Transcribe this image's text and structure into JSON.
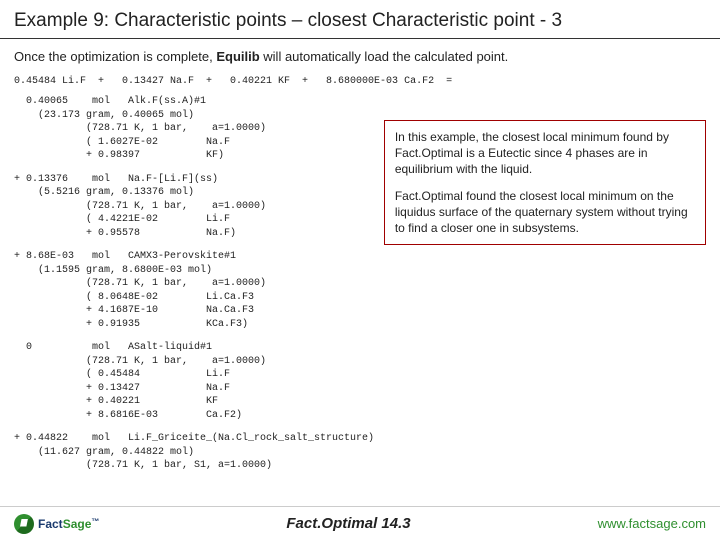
{
  "title": "Example 9: Characteristic points – closest Characteristic point - 3",
  "intro_before": "Once the optimization is complete, ",
  "intro_bold": "Equilib",
  "intro_after": " will automatically load the calculated point.",
  "equation": "0.45484 Li.F  +   0.13427 Na.F  +   0.40221 KF  +   8.680000E-03 Ca.F2  =",
  "blocks": [
    "  0.40065    mol   Alk.F(ss.A)#1\n    (23.173 gram, 0.40065 mol)\n            (728.71 K, 1 bar,    a=1.0000)\n            ( 1.6027E-02        Na.F\n            + 0.98397           KF)",
    "+ 0.13376    mol   Na.F-[Li.F](ss)\n    (5.5216 gram, 0.13376 mol)\n            (728.71 K, 1 bar,    a=1.0000)\n            ( 4.4221E-02        Li.F\n            + 0.95578           Na.F)",
    "+ 8.68E-03   mol   CAMX3-Perovskite#1\n    (1.1595 gram, 8.6800E-03 mol)\n            (728.71 K, 1 bar,    a=1.0000)\n            ( 8.0648E-02        Li.Ca.F3\n            + 4.1687E-10        Na.Ca.F3\n            + 0.91935           KCa.F3)",
    "  0          mol   ASalt-liquid#1\n            (728.71 K, 1 bar,    a=1.0000)\n            ( 0.45484           Li.F\n            + 0.13427           Na.F\n            + 0.40221           KF\n            + 8.6816E-03        Ca.F2)",
    "+ 0.44822    mol   Li.F_Griceite_(Na.Cl_rock_salt_structure)\n    (11.627 gram, 0.44822 mol)\n            (728.71 K, 1 bar, S1, a=1.0000)"
  ],
  "callout": {
    "p1": "In this example, the closest local minimum found by Fact.Optimal is a Eutectic since 4 phases are in equilibrium with the liquid.",
    "p2": "Fact.Optimal found the closest local minimum on the liquidus surface of the quaternary system without trying to find a closer one in subsystems."
  },
  "footer": {
    "logo_fact": "Fact",
    "logo_sage": "Sage",
    "center": "Fact.Optimal   14.3",
    "url": "www.factsage.com"
  }
}
